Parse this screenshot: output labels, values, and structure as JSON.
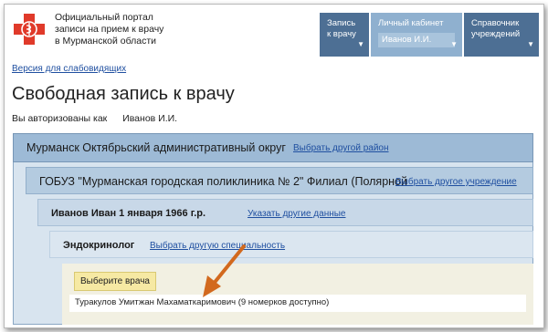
{
  "header": {
    "logo_lines": [
      "Официальный портал",
      "записи на прием к врачу",
      "в Мурманской области"
    ],
    "nav": [
      {
        "line1": "Запись",
        "line2": "к врачу"
      },
      {
        "line1": "Личный кабинет",
        "user": "Иванов И.И."
      },
      {
        "line1": "Справочник",
        "line2": "учреждений"
      }
    ],
    "accent_color": "#e03a2a",
    "nav_dark": "#4d6f94",
    "nav_light": "#8fb0cf"
  },
  "low_vision_link": "Версия для слабовидящих",
  "page_title": "Свободная запись к врачу",
  "auth": {
    "prefix": "Вы авторизованы как",
    "name": "Иванов И.И."
  },
  "panels": {
    "region": {
      "label": "Мурманск Октябрьский административный округ",
      "link": "Выбрать другой район"
    },
    "institution": {
      "label": "ГОБУЗ \"Мурманская городская поликлиника № 2\" Филиал (Полярной",
      "link": "Выбрать другое учреждение"
    },
    "patient": {
      "label": "Иванов Иван 1 января 1966 г.р.",
      "link": "Указать другие данные"
    },
    "specialty": {
      "label": "Эндокринолог",
      "link": "Выбрать другую специальность"
    },
    "doctor": {
      "button": "Выберите врача",
      "row": "Туракулов Умитжан Махаматкаримович (9 номерков доступно)"
    }
  }
}
